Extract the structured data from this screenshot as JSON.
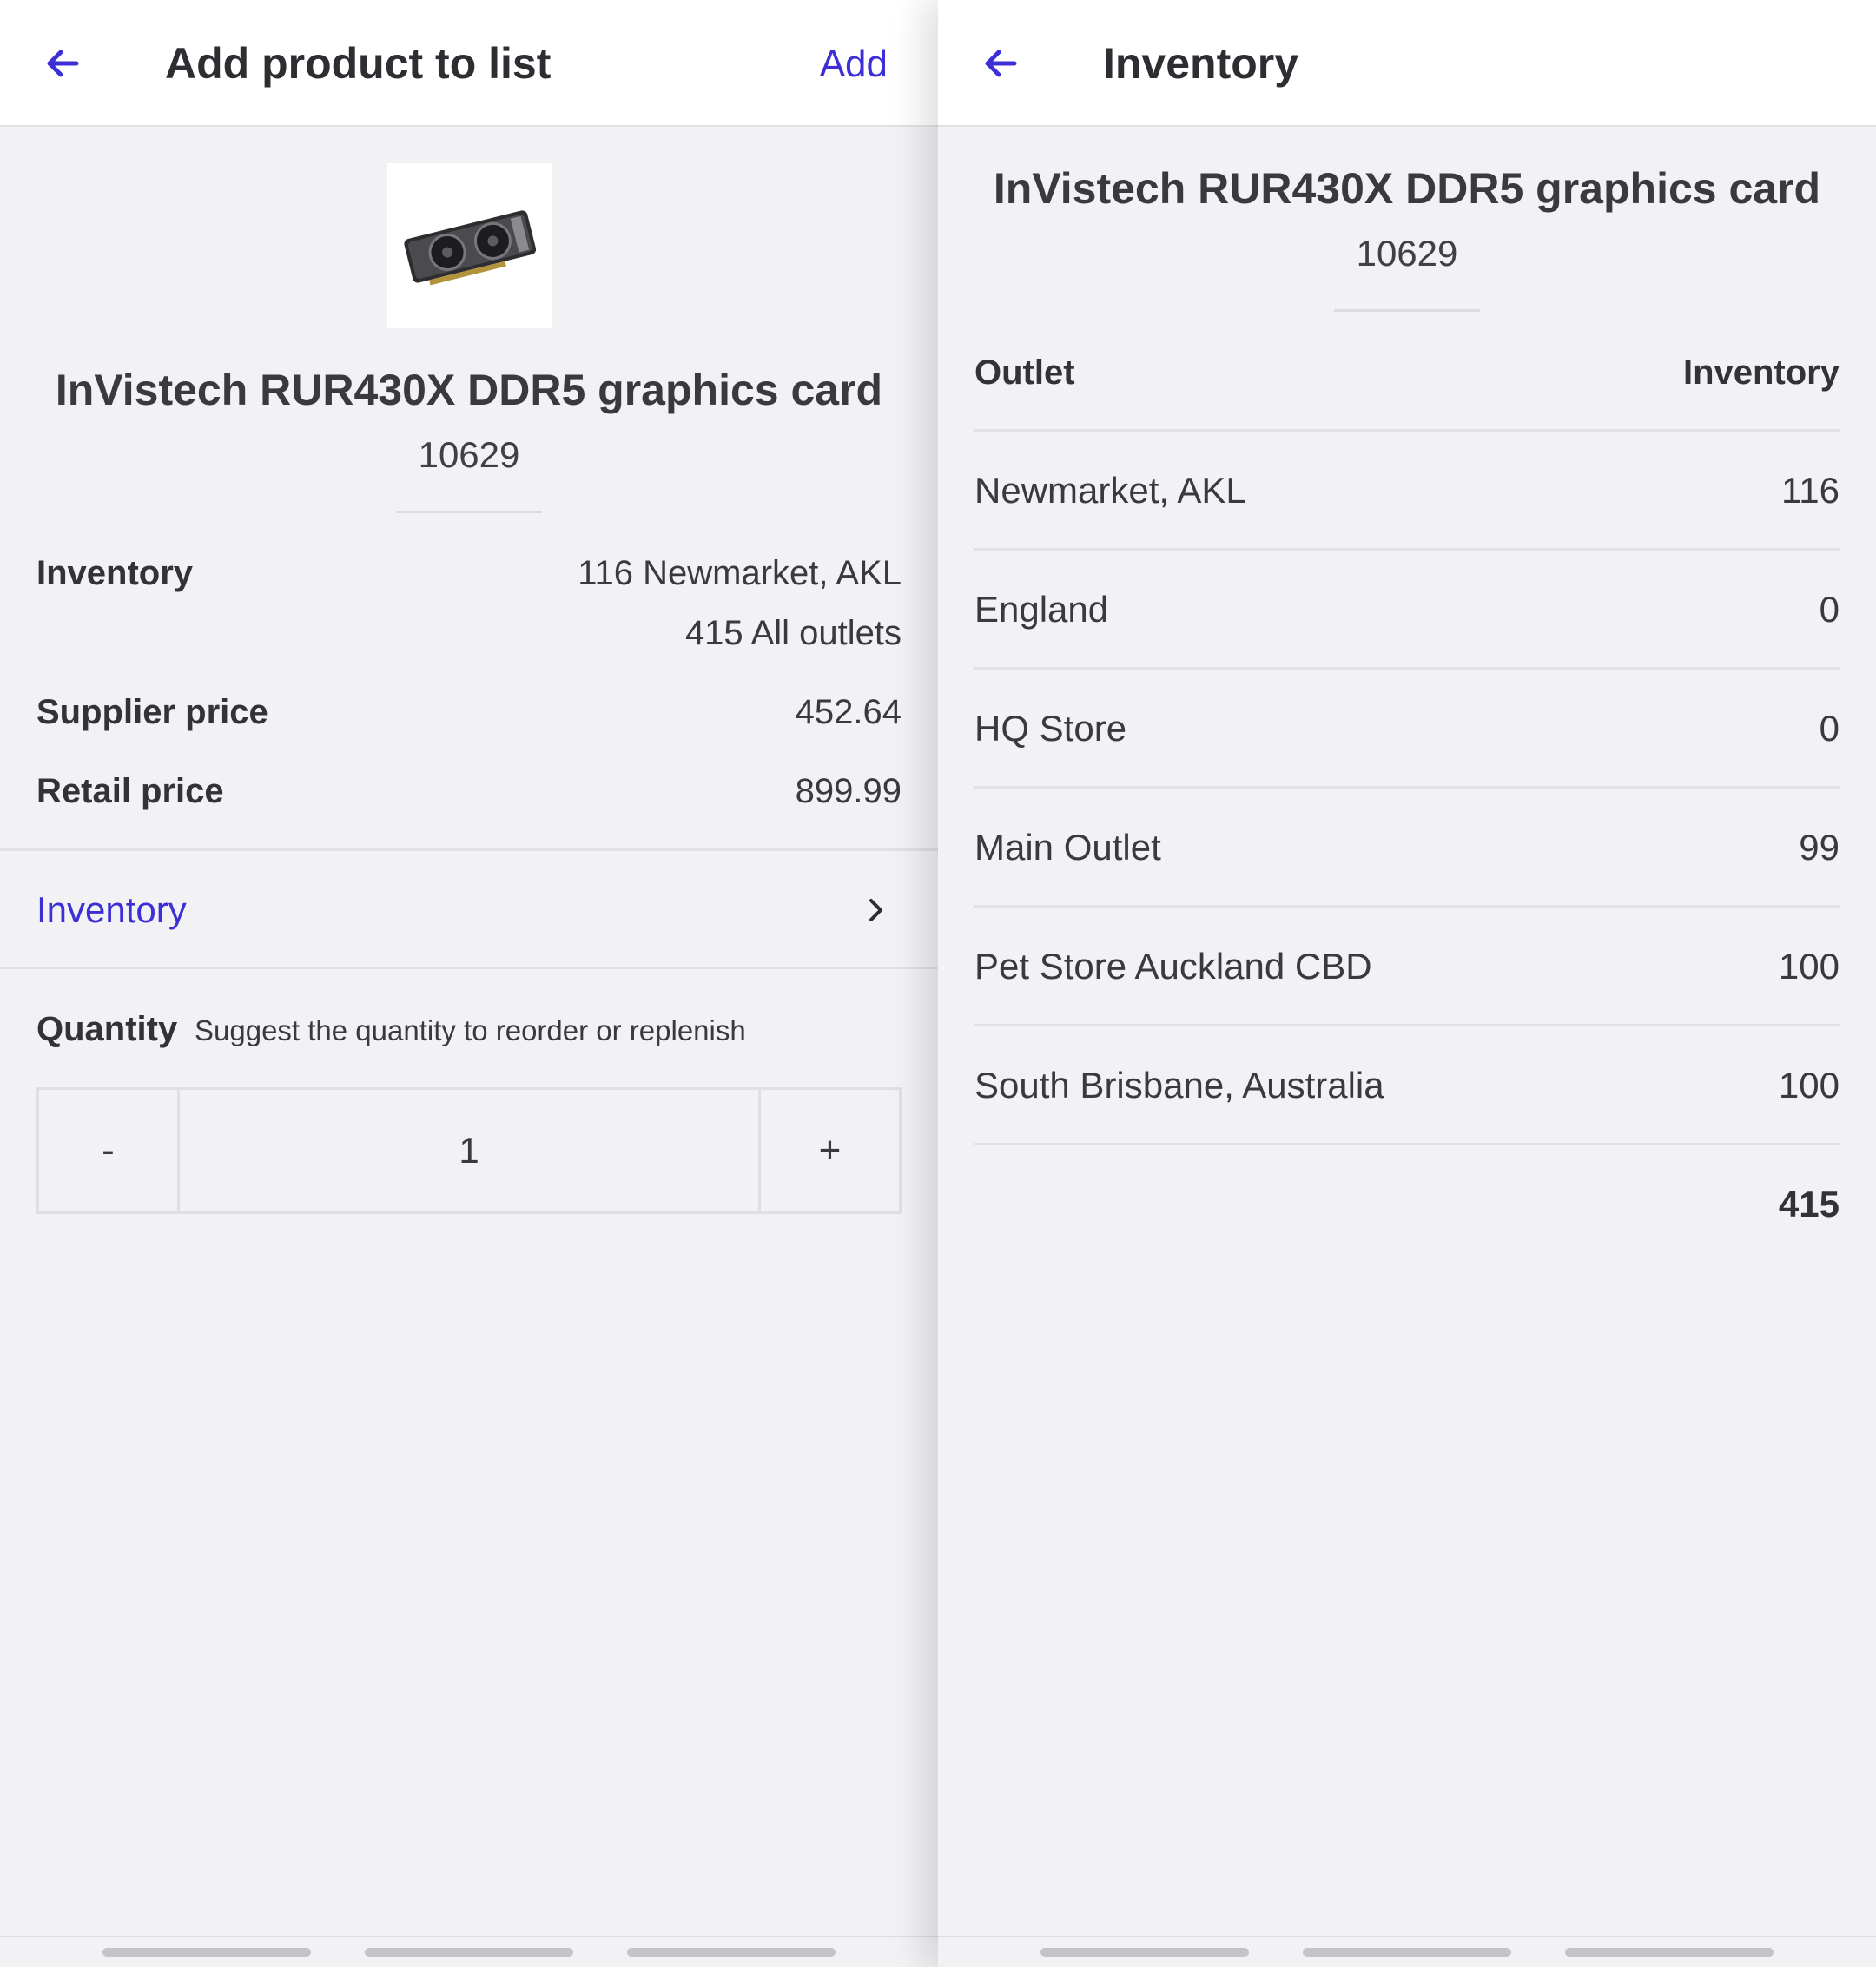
{
  "left_screen": {
    "appbar": {
      "back_icon": "arrow-left-icon",
      "title": "Add product to list",
      "action_label": "Add"
    },
    "product": {
      "image_icon": "graphics-card-image",
      "name": "InVistech RUR430X DDR5 graphics card",
      "sku": "10629"
    },
    "details": {
      "inventory_label": "Inventory",
      "inventory_local": "116 Newmarket, AKL",
      "inventory_all": "415 All outlets",
      "supplier_price_label": "Supplier price",
      "supplier_price": "452.64",
      "retail_price_label": "Retail price",
      "retail_price": "899.99"
    },
    "inventory_link": {
      "label": "Inventory",
      "icon": "chevron-right-icon"
    },
    "quantity": {
      "label": "Quantity",
      "hint": "Suggest the quantity to reorder or replenish",
      "minus_label": "-",
      "value": "1",
      "plus_label": "+"
    }
  },
  "right_screen": {
    "appbar": {
      "back_icon": "arrow-left-icon",
      "title": "Inventory"
    },
    "product": {
      "name": "InVistech RUR430X DDR5 graphics card",
      "sku": "10629"
    },
    "table": {
      "headers": [
        "Outlet",
        "Inventory"
      ],
      "rows": [
        {
          "outlet": "Newmarket, AKL",
          "count": "116"
        },
        {
          "outlet": "England",
          "count": "0"
        },
        {
          "outlet": "HQ Store",
          "count": "0"
        },
        {
          "outlet": "Main Outlet",
          "count": "99"
        },
        {
          "outlet": "Pet Store Auckland CBD",
          "count": "100"
        },
        {
          "outlet": "South Brisbane, Australia",
          "count": "100"
        }
      ],
      "total": "415"
    }
  },
  "colors": {
    "accent": "#3d2fd6",
    "background": "#f2f1f4",
    "appbar": "#ffffff",
    "divider": "#e1e0e5"
  }
}
